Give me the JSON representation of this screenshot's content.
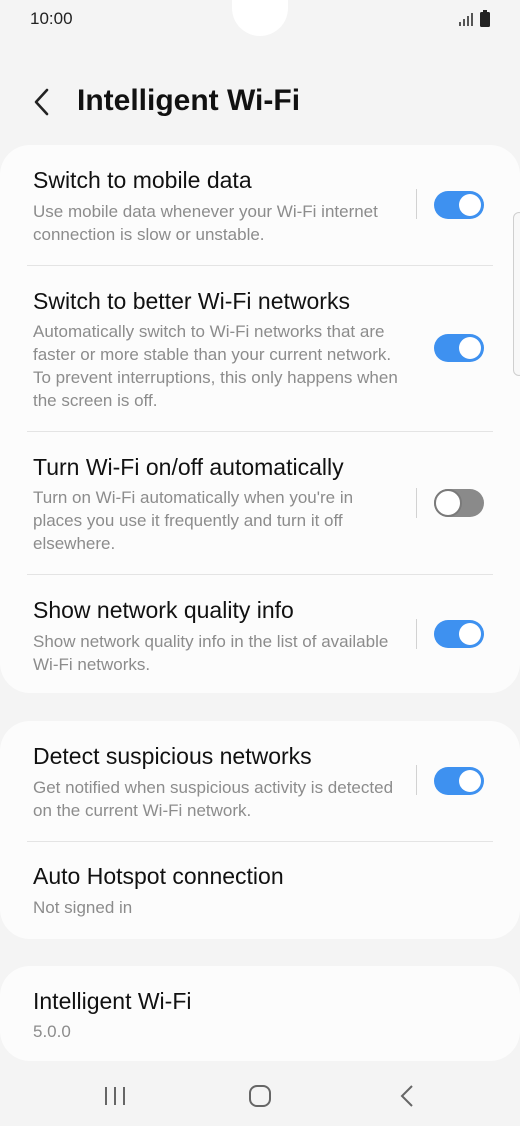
{
  "status_bar": {
    "time": "10:00"
  },
  "header": {
    "title": "Intelligent Wi-Fi"
  },
  "settings_card": {
    "items": [
      {
        "title": "Switch to mobile data",
        "description": "Use mobile data whenever your Wi-Fi internet connection is slow or unstable.",
        "toggle": "on"
      },
      {
        "title": "Switch to better Wi-Fi networks",
        "description": "Automatically switch to Wi-Fi networks that are faster or more stable than your current network. To prevent interruptions, this only happens when the screen is off.",
        "toggle": "on"
      },
      {
        "title": "Turn Wi-Fi on/off automatically",
        "description": "Turn on Wi-Fi automatically when you're in places you use it frequently and turn it off elsewhere.",
        "toggle": "off"
      },
      {
        "title": "Show network quality info",
        "description": "Show network quality info in the list of available Wi-Fi networks.",
        "toggle": "on"
      }
    ]
  },
  "security_card": {
    "items": [
      {
        "title": "Detect suspicious networks",
        "description": "Get notified when suspicious activity is detected on the current Wi-Fi network.",
        "toggle": "on"
      },
      {
        "title": "Auto Hotspot connection",
        "description": "Not signed in"
      }
    ]
  },
  "about_card": {
    "title": "Intelligent Wi-Fi",
    "version": "5.0.0"
  },
  "colors": {
    "accent": "#3e91f0",
    "toggle_off": "#8a8a8a",
    "background": "#f4f4f4",
    "card": "#fcfcfc"
  },
  "icons": {
    "signal": "signal-icon",
    "battery": "battery-icon",
    "back": "back-arrow-icon",
    "nav_recent": "recent-apps-icon",
    "nav_home": "home-icon",
    "nav_back": "back-icon"
  }
}
